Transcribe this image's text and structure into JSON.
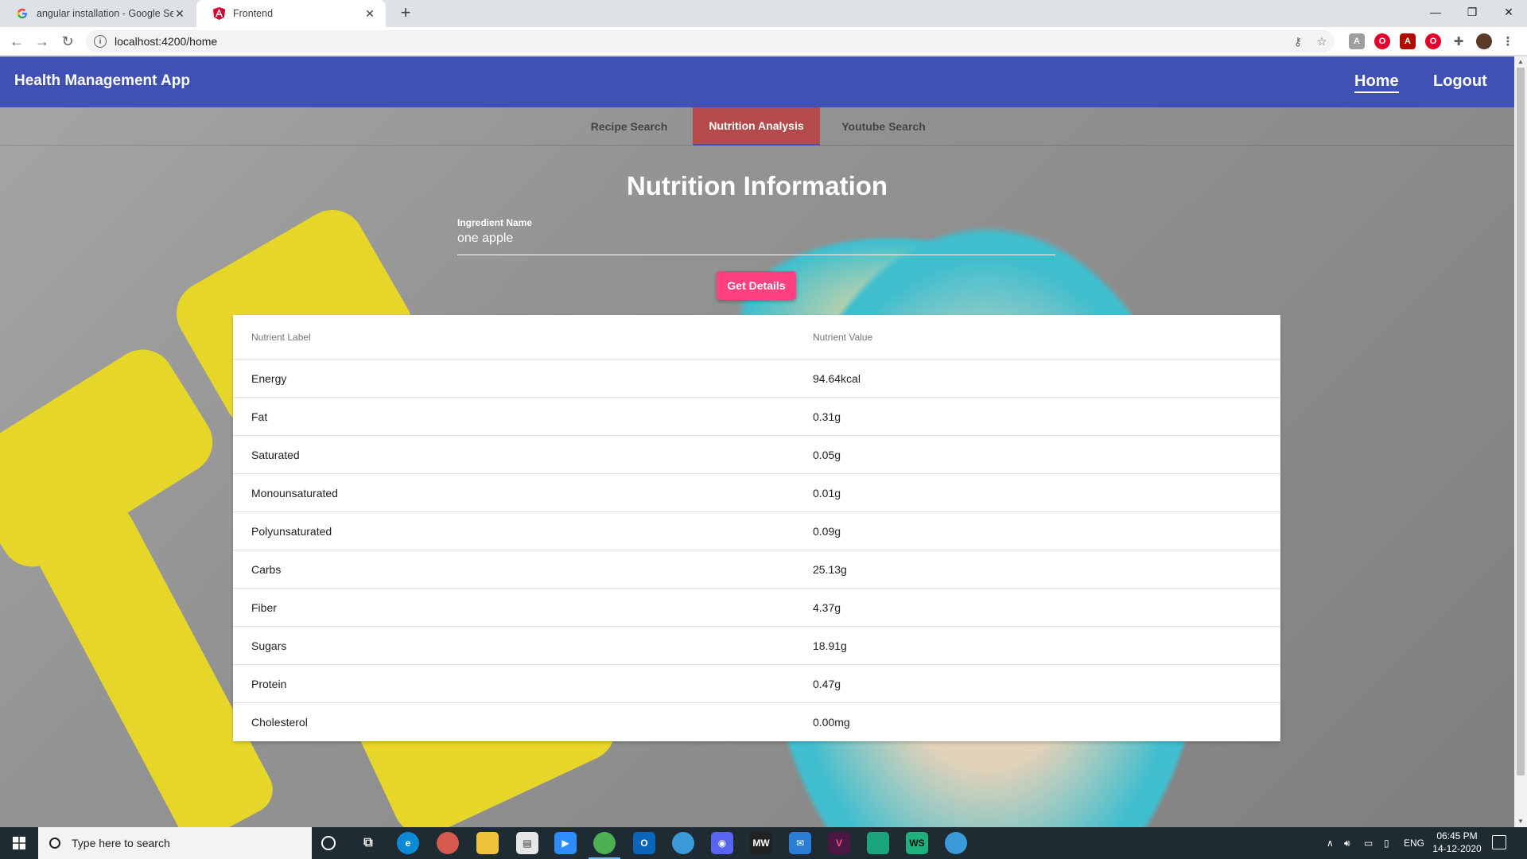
{
  "browser": {
    "tabs": [
      {
        "title": "angular installation - Google Sea",
        "favicon": "google-icon",
        "active": false
      },
      {
        "title": "Frontend",
        "favicon": "angular-icon",
        "active": true
      }
    ],
    "url": "localhost:4200/home"
  },
  "app": {
    "brand": "Health Management App",
    "nav": {
      "home": "Home",
      "logout": "Logout"
    },
    "tabs": [
      {
        "label": "Recipe Search",
        "active": false
      },
      {
        "label": "Nutrition Analysis",
        "active": true
      },
      {
        "label": "Youtube Search",
        "active": false
      }
    ],
    "heading": "Nutrition Information",
    "ingredient_field": {
      "label": "Ingredient Name",
      "value": "one apple"
    },
    "button_label": "Get Details",
    "table": {
      "headers": [
        "Nutrient Label",
        "Nutrient Value"
      ],
      "rows": [
        {
          "label": "Energy",
          "value": "94.64kcal"
        },
        {
          "label": "Fat",
          "value": "0.31g"
        },
        {
          "label": "Saturated",
          "value": "0.05g"
        },
        {
          "label": "Monounsaturated",
          "value": "0.01g"
        },
        {
          "label": "Polyunsaturated",
          "value": "0.09g"
        },
        {
          "label": "Carbs",
          "value": "25.13g"
        },
        {
          "label": "Fiber",
          "value": "4.37g"
        },
        {
          "label": "Sugars",
          "value": "18.91g"
        },
        {
          "label": "Protein",
          "value": "0.47g"
        },
        {
          "label": "Cholesterol",
          "value": "0.00mg"
        }
      ]
    }
  },
  "taskbar": {
    "search_placeholder": "Type here to search",
    "language": "ENG",
    "time": "06:45 PM",
    "date": "14-12-2020"
  },
  "colors": {
    "app_bar": "#3f51b5",
    "active_tab": "#b44a4a",
    "button": "#ff4081"
  }
}
